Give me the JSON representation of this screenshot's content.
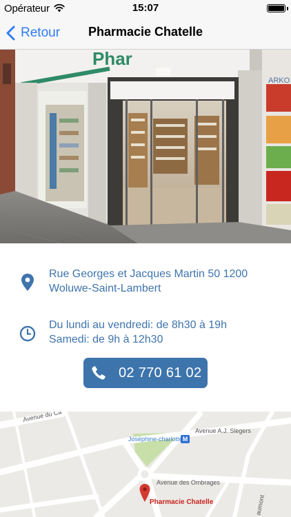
{
  "status": {
    "carrier": "Opérateur",
    "time": "15:07"
  },
  "nav": {
    "back_label": "Retour",
    "title": "Pharmacie Chatelle"
  },
  "photo": {
    "sign_text": "Phar"
  },
  "address": {
    "line1": "Rue Georges et Jacques Martin 50 1200",
    "line2": "Woluwe-Saint-Lambert",
    "icon": "location-pin-icon"
  },
  "hours": {
    "line1": "Du lundi au vendredi: de 8h30 à 19h",
    "line2": "Samedi: de 9h à 12h30",
    "icon": "clock-icon"
  },
  "phone": {
    "number": "02 770 61 02",
    "icon": "phone-icon"
  },
  "map": {
    "streets": {
      "avenue_du": "Avenue du Ca",
      "slegers": "Avenue A.J. Slegers",
      "ombrages": "Avenue des Ombrages",
      "aumont": "aumont"
    },
    "metro_station": "Joséphine-charlotte",
    "metro_badge": "M",
    "place_label": "Pharmacie Chatelle"
  },
  "colors": {
    "accent_blue": "#2f7cf6",
    "info_text": "#3f74ac",
    "button_bg": "#3d74ac",
    "map_pin": "#d33a2f"
  }
}
